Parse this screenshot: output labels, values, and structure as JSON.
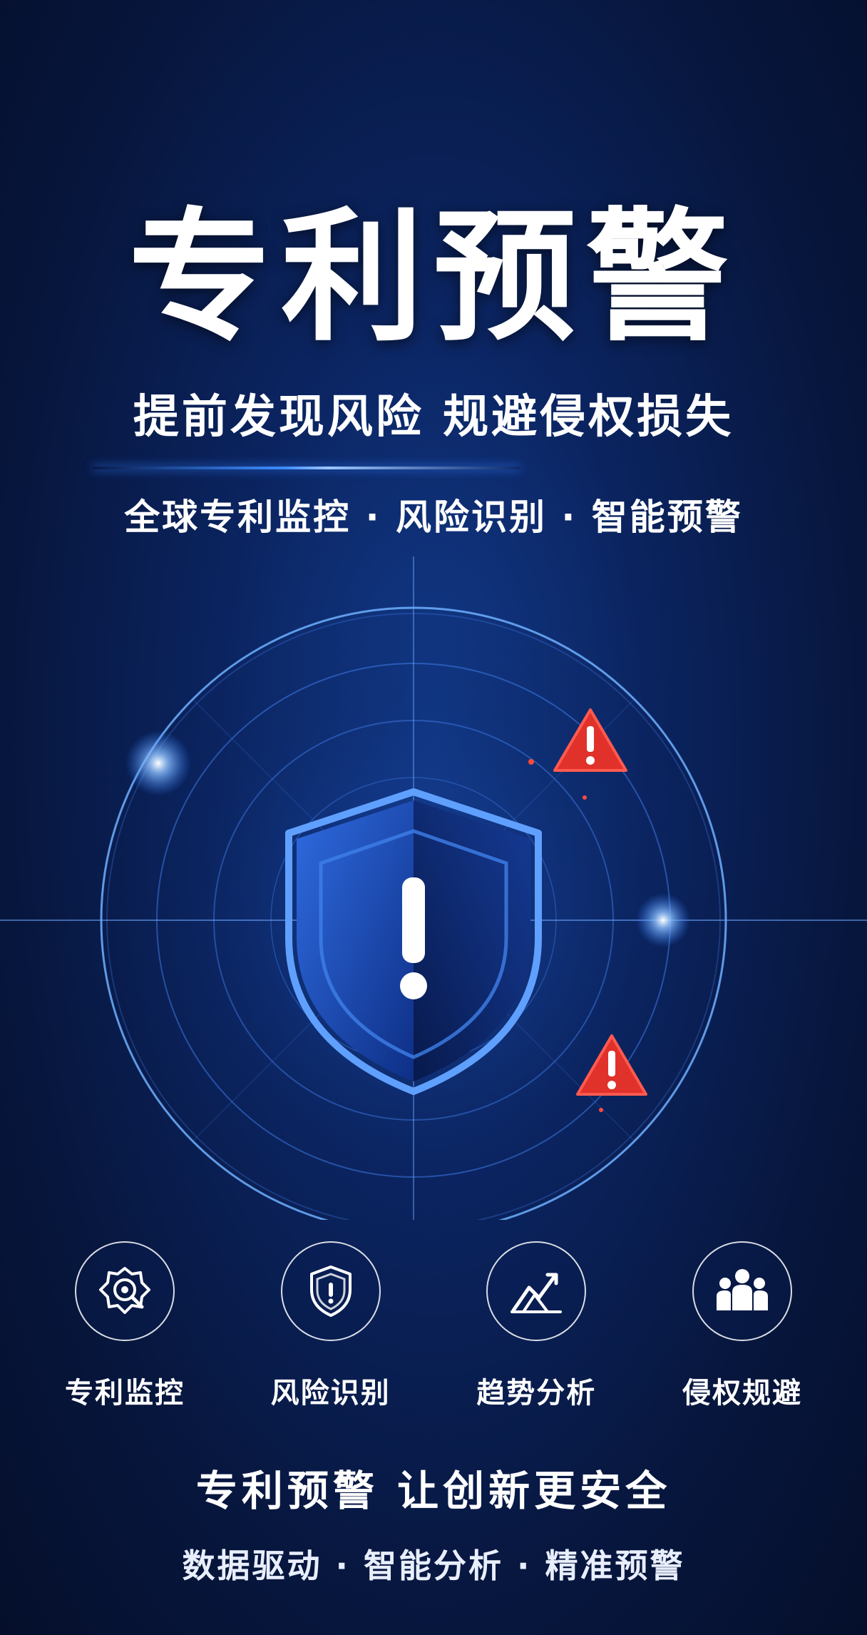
{
  "poster": {
    "title": "专利预警",
    "subtitle": "提前发现风险  规避侵权损失",
    "tagline": "全球专利监控 · 风险识别 · 智能预警",
    "features": [
      {
        "icon": "eye-monitor-icon",
        "label": "专利监控"
      },
      {
        "icon": "shield-alert-icon",
        "label": "风险识别"
      },
      {
        "icon": "trend-chart-icon",
        "label": "趋势分析"
      },
      {
        "icon": "people-group-icon",
        "label": "侵权规避"
      }
    ],
    "slogan": "专利预警  让创新更安全",
    "bottom_tagline": "数据驱动 · 智能分析 · 精准预警"
  },
  "colors": {
    "background": "#07163d",
    "accent_blue": "#3d8cff",
    "warning_red": "#e0312a",
    "text": "#ffffff"
  }
}
